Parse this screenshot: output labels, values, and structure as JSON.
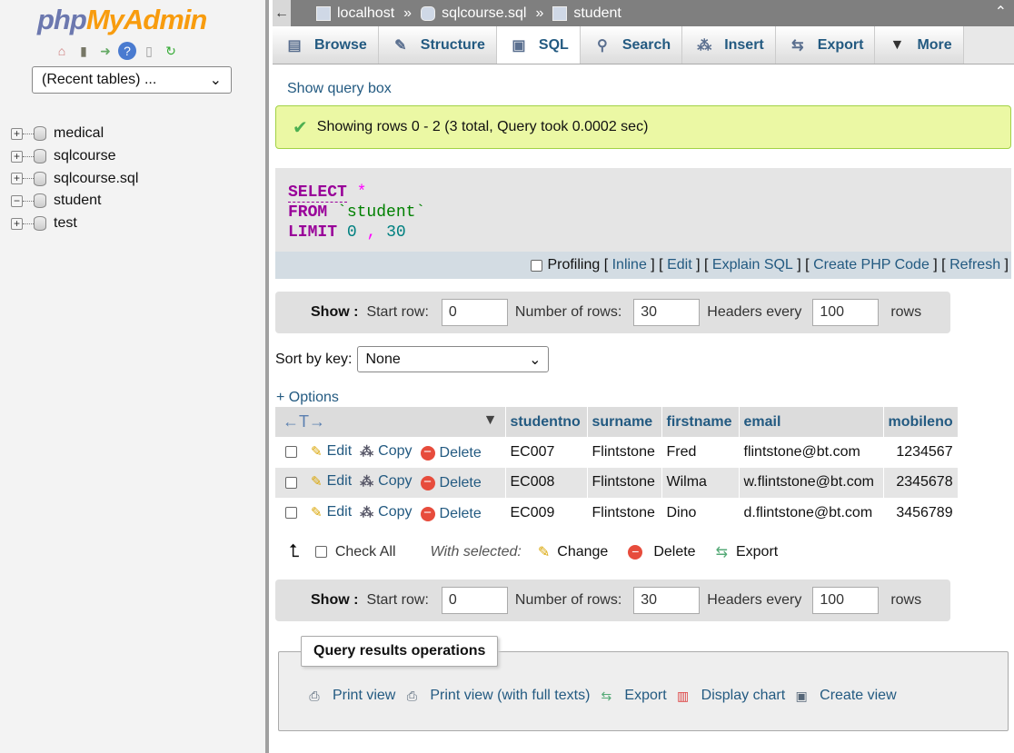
{
  "sidebar": {
    "logo_php": "php",
    "logo_myadmin": "MyAdmin",
    "recent": "(Recent tables) ...",
    "databases": [
      {
        "name": "medical",
        "toggle": "+"
      },
      {
        "name": "sqlcourse",
        "toggle": "+"
      },
      {
        "name": "sqlcourse.sql",
        "toggle": "+"
      },
      {
        "name": "student",
        "toggle": "−"
      },
      {
        "name": "test",
        "toggle": "+"
      }
    ]
  },
  "breadcrumb": {
    "server": "localhost",
    "database": "sqlcourse.sql",
    "table": "student",
    "sep": "»"
  },
  "tabs": [
    "Browse",
    "Structure",
    "SQL",
    "Search",
    "Insert",
    "Export",
    "More"
  ],
  "show_query_box": "Show query box",
  "success_message": "Showing rows 0 - 2 (3 total, Query took 0.0002 sec)",
  "sql": {
    "select": "SELECT",
    "star": "*",
    "from": "FROM",
    "table": "`student`",
    "limit": "LIMIT",
    "offset": "0",
    "comma": ",",
    "count": "30"
  },
  "sql_links": {
    "profiling": "Profiling",
    "inline": "Inline",
    "edit": "Edit",
    "explain": "Explain SQL",
    "php": "Create PHP Code",
    "refresh": "Refresh"
  },
  "nav": {
    "show": "Show :",
    "start_row_label": "Start row:",
    "start_row": "0",
    "num_rows_label": "Number of rows:",
    "num_rows": "30",
    "headers_label": "Headers every",
    "headers": "100",
    "rows": "rows"
  },
  "sort_by_key_label": "Sort by key:",
  "sort_by_key": "None",
  "options": "+ Options",
  "table": {
    "columns": [
      "studentno",
      "surname",
      "firstname",
      "email",
      "mobileno"
    ],
    "actions": {
      "edit": "Edit",
      "copy": "Copy",
      "delete": "Delete"
    },
    "rows": [
      [
        "EC007",
        "Flintstone",
        "Fred",
        "flintstone@bt.com",
        "1234567"
      ],
      [
        "EC008",
        "Flintstone",
        "Wilma",
        "w.flintstone@bt.com",
        "2345678"
      ],
      [
        "EC009",
        "Flintstone",
        "Dino",
        "d.flintstone@bt.com",
        "3456789"
      ]
    ]
  },
  "with_selected": {
    "check_all": "Check All",
    "label": "With selected:",
    "change": "Change",
    "delete": "Delete",
    "export": "Export"
  },
  "query_ops": {
    "title": "Query results operations",
    "print_view": "Print view",
    "print_full": "Print view (with full texts)",
    "export": "Export",
    "display_chart": "Display chart",
    "create_view": "Create view"
  }
}
